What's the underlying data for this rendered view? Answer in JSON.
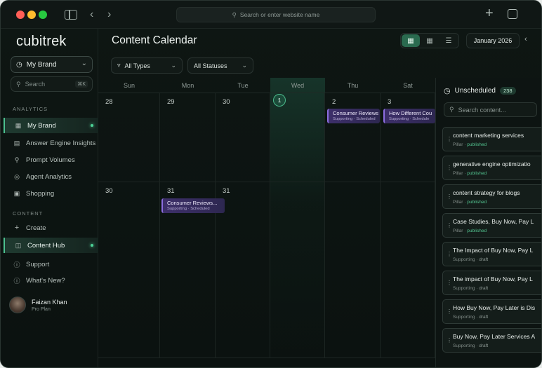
{
  "browser": {
    "url_placeholder": "Search or enter website name"
  },
  "sidebar": {
    "logo": "cubitrek",
    "brand_select": "My Brand",
    "search_placeholder": "Search",
    "search_shortcut": "⌘K",
    "section_analytics": "ANALYTICS",
    "section_content": "CONTENT",
    "items": [
      {
        "label": "My Brand",
        "icon": "grid-icon",
        "active": true
      },
      {
        "label": "Answer Engine Insights",
        "icon": "doc-icon",
        "active": false
      },
      {
        "label": "Prompt Volumes",
        "icon": "search-icon",
        "active": false
      },
      {
        "label": "Agent Analytics",
        "icon": "target-icon",
        "active": false
      },
      {
        "label": "Shopping",
        "icon": "bag-icon",
        "active": false
      },
      {
        "label": "Create",
        "icon": "plus-icon",
        "active": false
      },
      {
        "label": "Content Hub",
        "icon": "layers-icon",
        "active": true
      },
      {
        "label": "Support",
        "icon": "help-icon",
        "active": false
      },
      {
        "label": "What's New?",
        "icon": "info-icon",
        "active": false
      }
    ],
    "user": {
      "name": "Faizan Khan",
      "plan": "Pro Plan"
    }
  },
  "main": {
    "title": "Content Calendar",
    "month": "January 2026",
    "filters": {
      "types": "All Types",
      "statuses": "All Statuses"
    },
    "weekdays": [
      "Sun",
      "Mon",
      "Tue",
      "Wed",
      "Thu",
      "Sat"
    ],
    "week1": [
      "28",
      "29",
      "30",
      "1",
      "2",
      "3"
    ],
    "week2": [
      "30",
      "31",
      "31"
    ],
    "events": [
      {
        "title": "Consumer Reviews",
        "meta": "Supporting · Scheduled"
      },
      {
        "title": "How Different Cou",
        "meta": "Supporting · Schedule"
      },
      {
        "title": "Consumer Reviews...",
        "meta": "Supporting · Scheduled"
      }
    ]
  },
  "unscheduled": {
    "title": "Unscheduled",
    "count": "238",
    "search_placeholder": "Search content...",
    "items": [
      {
        "title": "content marketing services",
        "type": "Pillar",
        "status": "published"
      },
      {
        "title": "generative engine optimizatio",
        "type": "Pillar",
        "status": "published"
      },
      {
        "title": "content strategy for blogs",
        "type": "Pillar",
        "status": "published"
      },
      {
        "title": "Case Studies, Buy Now, Pay L",
        "type": "Pillar",
        "status": "published"
      },
      {
        "title": "The Impact of Buy Now, Pay L",
        "type": "Supporting",
        "status": "draft"
      },
      {
        "title": "The impact of Buy Now, Pay L",
        "type": "Supporting",
        "status": "draft"
      },
      {
        "title": "How Buy Now, Pay Later is Dis",
        "type": "Supporting",
        "status": "draft"
      },
      {
        "title": "Buy Now, Pay Later Services A",
        "type": "Supporting",
        "status": "draft"
      }
    ]
  },
  "colors": {
    "accent": "#4cc08f",
    "event": "#3d2f6a",
    "published": "#53c691"
  }
}
